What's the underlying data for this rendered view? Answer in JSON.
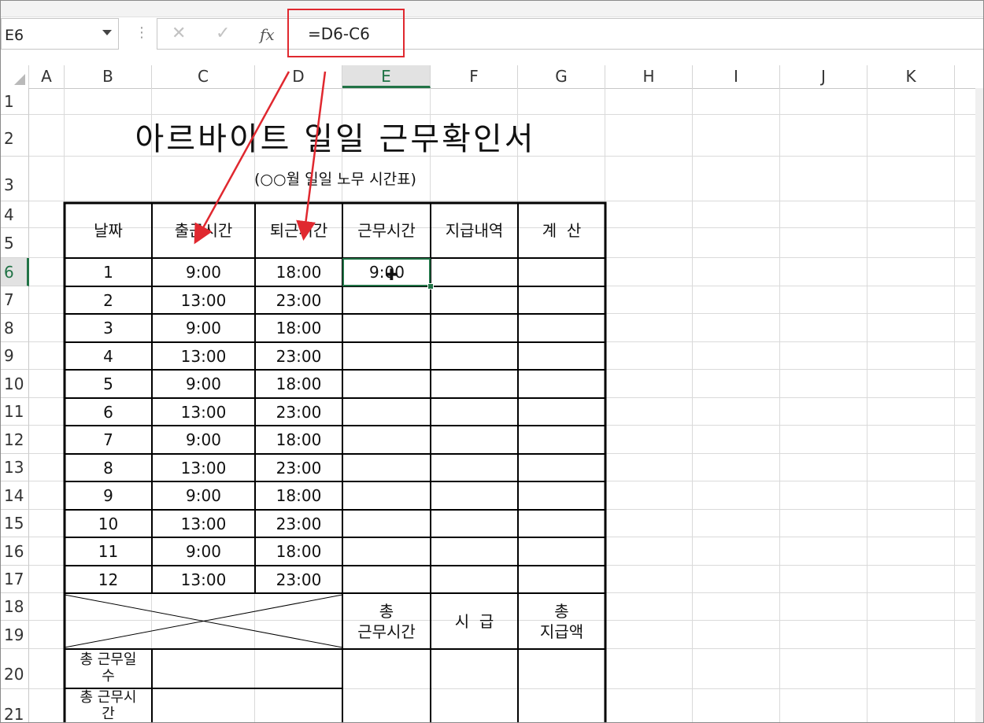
{
  "formula_bar": {
    "name_box": "E6",
    "cancel_icon": "✕",
    "enter_icon": "✓",
    "fx_label": "fx",
    "formula": "=D6-C6"
  },
  "columns": [
    "A",
    "B",
    "C",
    "D",
    "E",
    "F",
    "G",
    "H",
    "I",
    "J",
    "K"
  ],
  "rows": [
    "1",
    "2",
    "3",
    "4",
    "5",
    "6",
    "7",
    "8",
    "9",
    "10",
    "11",
    "12",
    "13",
    "14",
    "15",
    "16",
    "17",
    "18",
    "19",
    "20",
    "21"
  ],
  "selected_cell": "E6",
  "sheet": {
    "title": "아르바이트 일일 근무확인서",
    "subtitle": "(○○월 일일 노무 시간표)",
    "headers": {
      "date": "날짜",
      "start": "출근시간",
      "end": "퇴근시간",
      "worktime": "근무시간",
      "payment": "지급내역",
      "calc": "계  산"
    },
    "rows": [
      {
        "day": "1",
        "start": "9:00",
        "end": "18:00",
        "work": "9:00"
      },
      {
        "day": "2",
        "start": "13:00",
        "end": "23:00",
        "work": ""
      },
      {
        "day": "3",
        "start": "9:00",
        "end": "18:00",
        "work": ""
      },
      {
        "day": "4",
        "start": "13:00",
        "end": "23:00",
        "work": ""
      },
      {
        "day": "5",
        "start": "9:00",
        "end": "18:00",
        "work": ""
      },
      {
        "day": "6",
        "start": "13:00",
        "end": "23:00",
        "work": ""
      },
      {
        "day": "7",
        "start": "9:00",
        "end": "18:00",
        "work": ""
      },
      {
        "day": "8",
        "start": "13:00",
        "end": "23:00",
        "work": ""
      },
      {
        "day": "9",
        "start": "9:00",
        "end": "18:00",
        "work": ""
      },
      {
        "day": "10",
        "start": "13:00",
        "end": "23:00",
        "work": ""
      },
      {
        "day": "11",
        "start": "9:00",
        "end": "18:00",
        "work": ""
      },
      {
        "day": "12",
        "start": "13:00",
        "end": "23:00",
        "work": ""
      }
    ],
    "summary": {
      "total_work_time": "총\n근무시간",
      "hourly_wage": "시  급",
      "total_payment": "총\n지급액",
      "total_work_days": "총 근무일\n수",
      "total_work_hours": "총 근무시\n간"
    }
  },
  "annotations": {
    "highlight_color": "#e0282f",
    "accent_color": "#217346"
  }
}
